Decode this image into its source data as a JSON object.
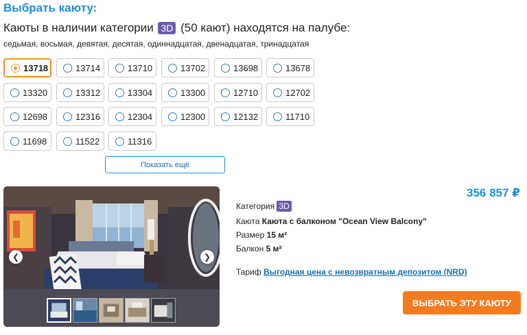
{
  "header": {
    "title": "Выбрать каюту:",
    "subtitle_before": "Каюты в наличии категории",
    "category_badge": "3D",
    "subtitle_after": "(50 кают) находятся на палубе:",
    "decks": "седьмая, восьмая, девятая, десятая, одиннадцатая, двенадцатая, тринадцатая"
  },
  "cabins": {
    "selected": "13718",
    "items": [
      "13718",
      "13714",
      "13710",
      "13702",
      "13698",
      "13678",
      "13320",
      "13312",
      "13304",
      "13300",
      "12710",
      "12702",
      "12698",
      "12316",
      "12304",
      "12300",
      "12132",
      "11710",
      "11698",
      "11522",
      "11316"
    ],
    "show_more_label": "Показать ещё"
  },
  "gallery": {
    "prev_icon": "chevron-left-icon",
    "next_icon": "chevron-right-icon",
    "thumbnail_count": 5,
    "active_thumbnail": 1
  },
  "details": {
    "price": "356 857 ₽",
    "category_label": "Категория",
    "category_value": "3D",
    "cabin_label": "Каюта",
    "cabin_value": "Каюта с балконом \"Ocean View Balcony\"",
    "size_label": "Размер",
    "size_value": "15 м²",
    "balcony_label": "Балкон",
    "balcony_value": "5 м²",
    "tariff_label": "Тариф",
    "tariff_value": "Выгодная цена с невозвратным депозитом (NRD)",
    "select_button": "ВЫБРАТЬ ЭТУ КАЮТУ"
  },
  "colors": {
    "accent_blue": "#1a8fd8",
    "accent_orange": "#f47b20",
    "badge_purple": "#6e5ab0"
  }
}
